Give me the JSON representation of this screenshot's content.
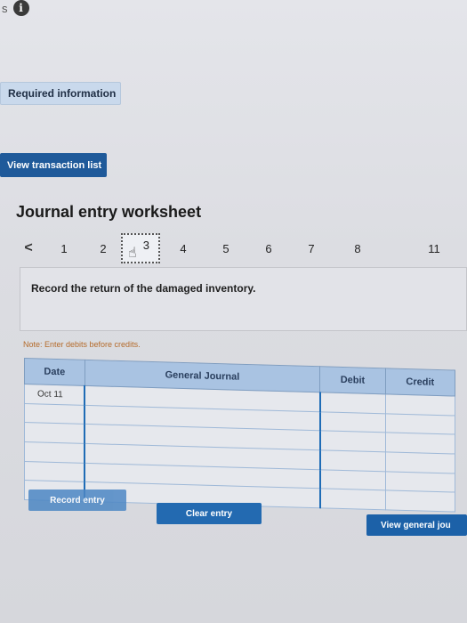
{
  "top": {
    "fragment": "s"
  },
  "banner": {
    "required_label": "Required information"
  },
  "buttons": {
    "view_transaction_list": "View transaction list",
    "record_entry": "Record entry",
    "clear_entry": "Clear entry",
    "view_general_journal": "View general jou"
  },
  "worksheet": {
    "title": "Journal entry worksheet",
    "nav": {
      "prev": "<",
      "items": [
        "1",
        "2",
        "3",
        "4",
        "5",
        "6",
        "7",
        "8",
        "11"
      ],
      "current": "3"
    },
    "instruction": "Record the return of the damaged inventory.",
    "note": "Note: Enter debits before credits."
  },
  "table": {
    "headers": {
      "date": "Date",
      "general_journal": "General Journal",
      "debit": "Debit",
      "credit": "Credit"
    },
    "rows": [
      {
        "date": "Oct 11",
        "account": "",
        "debit": "",
        "credit": ""
      },
      {
        "date": "",
        "account": "",
        "debit": "",
        "credit": ""
      },
      {
        "date": "",
        "account": "",
        "debit": "",
        "credit": ""
      },
      {
        "date": "",
        "account": "",
        "debit": "",
        "credit": ""
      },
      {
        "date": "",
        "account": "",
        "debit": "",
        "credit": ""
      },
      {
        "date": "",
        "account": "",
        "debit": "",
        "credit": ""
      }
    ]
  },
  "colors": {
    "primary_button": "#236ab1",
    "header_fill": "#a9c3e2",
    "note": "#b46b2a"
  }
}
